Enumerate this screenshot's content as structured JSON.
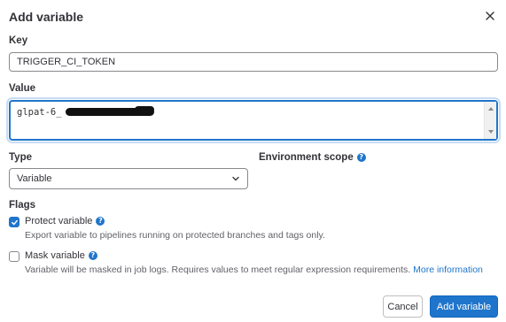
{
  "dialog": {
    "title": "Add variable"
  },
  "key": {
    "label": "Key",
    "value": "TRIGGER_CI_TOKEN"
  },
  "value": {
    "label": "Value",
    "visible_text": "glpat-6_"
  },
  "type": {
    "label": "Type",
    "selected": "Variable"
  },
  "environment_scope": {
    "label": "Environment scope"
  },
  "flags": {
    "label": "Flags",
    "protect": {
      "label": "Protect variable",
      "help": "Export variable to pipelines running on protected branches and tags only.",
      "checked": true
    },
    "mask": {
      "label": "Mask variable",
      "help": "Variable will be masked in job logs. Requires values to meet regular expression requirements.",
      "link": "More information",
      "checked": false
    }
  },
  "actions": {
    "cancel": "Cancel",
    "submit": "Add variable"
  },
  "colors": {
    "primary": "#1f75cb",
    "text": "#333238",
    "muted": "#626168"
  }
}
